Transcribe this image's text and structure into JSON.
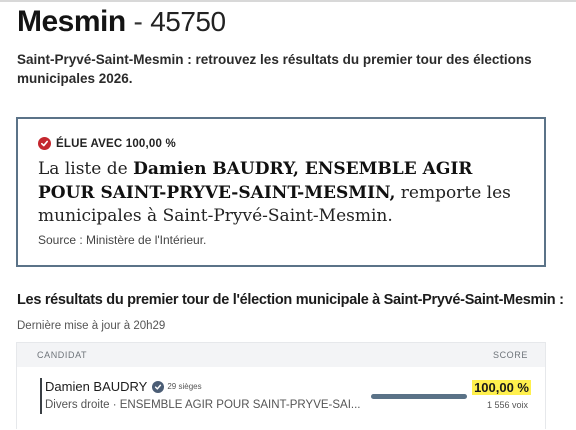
{
  "header": {
    "city": "Mesmin",
    "separator": "-",
    "postal_code": "45750"
  },
  "intro": "Saint-Pryvé-Saint-Mesmin : retrouvez les résultats du premier tour des élections municipales 2026.",
  "result_box": {
    "elue_label": "ÉLUE AVEC 100,00 %",
    "statement_before": "La liste de ",
    "statement_strong": "Damien BAUDRY, ENSEMBLE AGIR POUR SAINT-PRYVE-SAINT-MESMIN,",
    "statement_after": " remporte les municipales à Saint-Pryvé-Saint-Mesmin.",
    "source": "Source : Ministère de l'Intérieur."
  },
  "results": {
    "title": "Les résultats du premier tour de l'élection municipale à Saint-Pryvé-Saint-Mesmin :",
    "updated": "Dernière mise à jour à 20h29",
    "col_candidat": "CANDIDAT",
    "col_score": "SCORE",
    "rows": [
      {
        "name": "Damien BAUDRY",
        "seats": "29 sièges",
        "list": "Divers droite · ENSEMBLE AGIR POUR SAINT-PRYVE-SAI...",
        "score_pct": "100,00 %",
        "score_value": 100,
        "votes": "1 556 voix"
      }
    ]
  },
  "colors": {
    "accent_border": "#5b7388",
    "elue_red": "#c4262e",
    "bar_fill": "#5a7287",
    "highlight": "#fff04d"
  },
  "icons": {
    "elue": "check-circle-icon",
    "verified": "verified-badge-icon"
  }
}
